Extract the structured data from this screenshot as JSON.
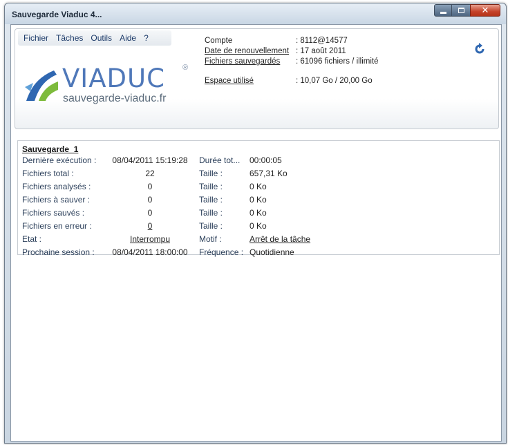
{
  "window": {
    "title": "Sauvegarde Viaduc 4...",
    "controls": {
      "minimize": "minimize-icon",
      "maximize": "maximize-icon",
      "close": "close-icon"
    }
  },
  "menu": [
    "Fichier",
    "Tâches",
    "Outils",
    "Aide",
    "?"
  ],
  "logo": {
    "word": "VIADUC",
    "registered": "®",
    "url": "sauvegarde-viaduc.fr"
  },
  "account": {
    "compte_label": "Compte",
    "compte_value": ": 8112@14577",
    "renouvellement_label": "Date de renouvellement",
    "renouvellement_value": ": 17 août 2011",
    "fichiers_label": "Fichiers sauvegardés",
    "fichiers_value": ": 61096 fichiers / illimité",
    "espace_label": "Espace utilisé",
    "espace_value": ": 10,07 Go / 20,00 Go"
  },
  "refresh_icon": "refresh-icon",
  "task": {
    "title": "Sauvegarde_1",
    "rows": [
      {
        "label": "Dernière exécution :",
        "value": "08/04/2011 15:19:28",
        "label2": "Durée tot...",
        "value2": "00:00:05"
      },
      {
        "label": "Fichiers total :",
        "value": "22",
        "label2": "Taille :",
        "value2": "657,31 Ko"
      },
      {
        "label": "Fichiers analysés :",
        "value": "0",
        "label2": "Taille :",
        "value2": "0 Ko"
      },
      {
        "label": "Fichiers à sauver :",
        "value": "0",
        "label2": "Taille :",
        "value2": "0 Ko"
      },
      {
        "label": "Fichiers sauvés :",
        "value": "0",
        "label2": "Taille :",
        "value2": "0 Ko"
      },
      {
        "label": "Fichiers en erreur :",
        "value": "0",
        "label2": "Taille :",
        "value2": "0 Ko"
      },
      {
        "label": "Etat :",
        "value": "Interrompu",
        "label2": "Motif :",
        "value2": "Arrêt de la tâche"
      },
      {
        "label": "Prochaine session :",
        "value": "08/04/2011 18:00:00",
        "label2": "Fréquence :",
        "value2": "Quotidienne"
      }
    ]
  },
  "colors": {
    "accent": "#4f78b9",
    "logo_green": "#7dbb3c",
    "logo_blue": "#2f67b1"
  }
}
